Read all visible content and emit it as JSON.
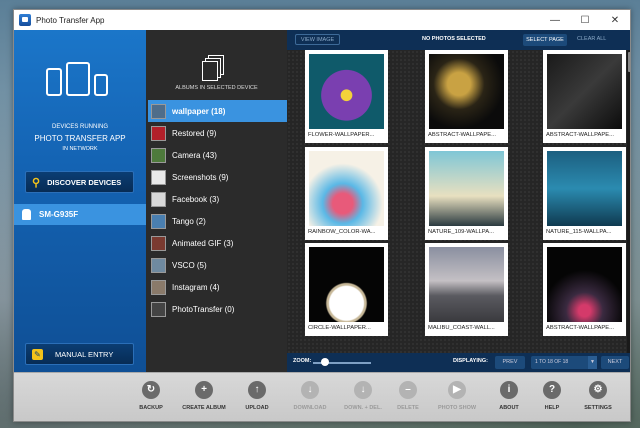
{
  "window": {
    "title": "Photo Transfer App",
    "minimize": "—",
    "maximize": "☐",
    "close": "✕"
  },
  "left": {
    "running1": "DEVICES RUNNING",
    "running2": "PHOTO TRANSFER APP",
    "running3": "IN NETWORK",
    "discover": "DISCOVER DEVICES",
    "device": "SM-G935F",
    "manual": "MANUAL ENTRY"
  },
  "albums": {
    "title": "ALBUMS IN SELECTED DEVICE",
    "items": [
      {
        "label": "wallpaper (18)",
        "color": "#4f6d8a"
      },
      {
        "label": "Restored (9)",
        "color": "#b2202a"
      },
      {
        "label": "Camera (43)",
        "color": "#4e7a3c"
      },
      {
        "label": "Screenshots (9)",
        "color": "#e9e9e9"
      },
      {
        "label": "Facebook (3)",
        "color": "#d8d8d8"
      },
      {
        "label": "Tango (2)",
        "color": "#4a7fb0"
      },
      {
        "label": "Animated GIF (3)",
        "color": "#7a3a30"
      },
      {
        "label": "VSCO (5)",
        "color": "#6f8aa0"
      },
      {
        "label": "Instagram (4)",
        "color": "#8a7a6a"
      },
      {
        "label": "PhotoTransfer (0)",
        "color": "#444444"
      }
    ]
  },
  "photos": {
    "view": "VIEW IMAGE",
    "status": "NO PHOTOS SELECTED",
    "select_page": "SELECT PAGE",
    "clear_all": "CLEAR ALL",
    "cells": [
      {
        "cap": "FLOWER-WALLPAPER...",
        "bg": "radial-gradient(circle at 50% 55%,#f3d23a 0 10%,#7a3fb0 11% 45%,#0f5a6a 46% 100%)"
      },
      {
        "cap": "ABSTRACT-WALLPAPE...",
        "bg": "radial-gradient(ellipse at 40% 40%,#c9a243 0 18%,#2a2416 40%,#0b0b0b 70%)"
      },
      {
        "cap": "ABSTRACT-WALLPAPE...",
        "bg": "linear-gradient(135deg,#1a1a1a,#3a3a3a 50%,#0c0c0c)"
      },
      {
        "cap": "RAINBOW_COLOR-WA...",
        "bg": "radial-gradient(circle at 45% 70%,#e85a7a 0 15%,#5ab8e6 30%,#f6f1e6 60%)"
      },
      {
        "cap": "NATURE_109-WALLPA...",
        "bg": "linear-gradient(180deg,#7fc6d6,#e8e0c0 60%,#2a3a40)"
      },
      {
        "cap": "NATURE_115-WALLPA...",
        "bg": "linear-gradient(180deg,#1c5f80,#2b8bb0 50%,#0f3a50)"
      },
      {
        "cap": "CIRCLE-WALLPAPER...",
        "bg": "radial-gradient(circle at 50% 75%,transparent 0 25%,#c7b898 27% 29%,#050505 31%)"
      },
      {
        "cap": "MALIBU_COAST-WALL...",
        "bg": "linear-gradient(180deg,#8a8fa0,#c4c0c4 45%,#5a5a60 65%,#3a3a3e)"
      },
      {
        "cap": "ABSTRACT-WALLPAPE...",
        "bg": "radial-gradient(circle at 50% 85%,#d43a6a 0 8%,#3a2a40 25%,#050505 55%)"
      }
    ],
    "zoom": "ZOOM:",
    "displaying": "DISPLAYING:",
    "prev": "PREV",
    "range": "1 TO 18 OF 18",
    "next": "NEXT"
  },
  "toolbar": [
    {
      "label": "BACKUP",
      "glyph": "↻",
      "enabled": true
    },
    {
      "label": "CREATE ALBUM",
      "glyph": "+",
      "enabled": true
    },
    {
      "label": "UPLOAD",
      "glyph": "↑",
      "enabled": true
    },
    {
      "label": "DOWNLOAD",
      "glyph": "↓",
      "enabled": false
    },
    {
      "label": "DOWN. + DEL.",
      "glyph": "↓",
      "enabled": false
    },
    {
      "label": "DELETE",
      "glyph": "–",
      "enabled": false
    },
    {
      "label": "PHOTO SHOW",
      "glyph": "▶",
      "enabled": false
    },
    {
      "label": "ABOUT",
      "glyph": "i",
      "enabled": true
    },
    {
      "label": "HELP",
      "glyph": "?",
      "enabled": true
    },
    {
      "label": "SETTINGS",
      "glyph": "⚙",
      "enabled": true
    }
  ]
}
